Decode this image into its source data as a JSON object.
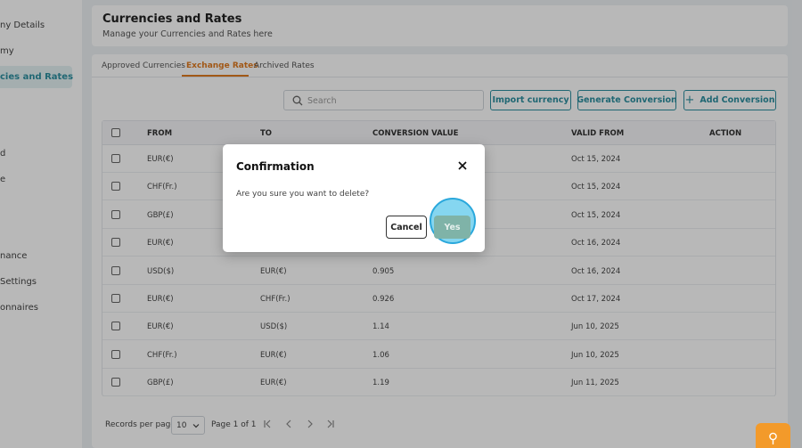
{
  "sidebar": {
    "items": [
      {
        "label": "ny Details"
      },
      {
        "label": "my"
      },
      {
        "label": "cies and Rates"
      },
      {
        "label": "d"
      },
      {
        "label": "e"
      },
      {
        "label": "nance"
      },
      {
        "label": " Settings"
      },
      {
        "label": "onnaires"
      }
    ]
  },
  "header": {
    "title": "Currencies and Rates",
    "subtitle": "Manage your Currencies and Rates here"
  },
  "tabs": [
    {
      "label": "Approved Currencies"
    },
    {
      "label": "Exchange Rates"
    },
    {
      "label": "Archived Rates"
    }
  ],
  "toolbar": {
    "search_placeholder": "Search",
    "import_label": "Import currency",
    "generate_label": "Generate Conversion",
    "add_label": "Add Conversion"
  },
  "table": {
    "headers": [
      "FROM",
      "TO",
      "CONVERSION VALUE",
      "VALID FROM",
      "ACTION"
    ],
    "rows": [
      {
        "from": "EUR(€)",
        "to": "",
        "value": "",
        "valid_from": "Oct 15, 2024"
      },
      {
        "from": "CHF(Fr.)",
        "to": "",
        "value": "",
        "valid_from": "Oct 15, 2024"
      },
      {
        "from": "GBP(£)",
        "to": "",
        "value": "",
        "valid_from": "Oct 15, 2024"
      },
      {
        "from": "EUR(€)",
        "to": "",
        "value": "",
        "valid_from": "Oct 16, 2024"
      },
      {
        "from": "USD($)",
        "to": "EUR(€)",
        "value": "0.905",
        "valid_from": "Oct 16, 2024"
      },
      {
        "from": "EUR(€)",
        "to": "CHF(Fr.)",
        "value": "0.926",
        "valid_from": "Oct 17, 2024"
      },
      {
        "from": "EUR(€)",
        "to": "USD($)",
        "value": "1.14",
        "valid_from": "Jun 10, 2025"
      },
      {
        "from": "CHF(Fr.)",
        "to": "EUR(€)",
        "value": "1.06",
        "valid_from": "Jun 10, 2025"
      },
      {
        "from": "GBP(£)",
        "to": "EUR(€)",
        "value": "1.19",
        "valid_from": "Jun 11, 2025"
      }
    ]
  },
  "pagination": {
    "records_label": "Records per page",
    "per_page": "10",
    "page_info": "Page 1 of 1"
  },
  "modal": {
    "title": "Confirmation",
    "message": "Are you sure you want to delete?",
    "cancel_label": "Cancel",
    "yes_label": "Yes"
  },
  "colors": {
    "accent": "#2d8fa0",
    "active_tab": "#e07a1f",
    "help_button": "#f39a2a"
  }
}
